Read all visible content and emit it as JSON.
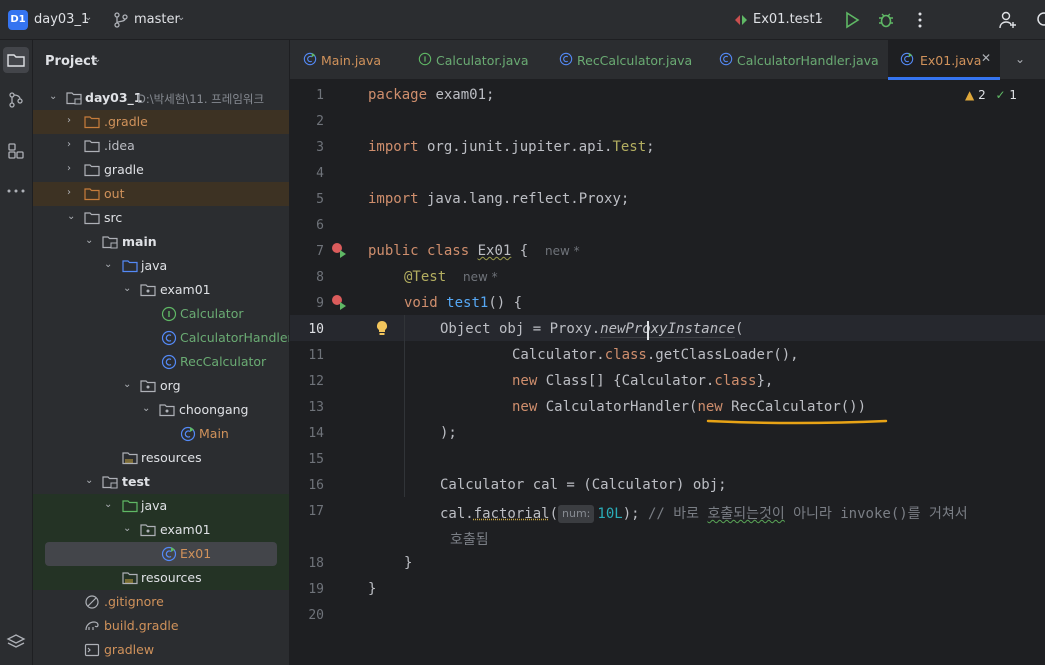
{
  "topbar": {
    "project_badge": "D1",
    "project_name": "day03_1",
    "branch": "master",
    "run_config": "Ex01.test1"
  },
  "project_panel": {
    "title": "Project",
    "root_name": "day03_1",
    "root_path": "D:\\박세현\\11. 프레임워크",
    "items": [
      {
        "label": ".gradle"
      },
      {
        "label": ".idea"
      },
      {
        "label": "gradle"
      },
      {
        "label": "out"
      },
      {
        "label": "src"
      },
      {
        "label": "main"
      },
      {
        "label": "java"
      },
      {
        "label": "exam01"
      },
      {
        "label": "Calculator"
      },
      {
        "label": "CalculatorHandler"
      },
      {
        "label": "RecCalculator"
      },
      {
        "label": "org"
      },
      {
        "label": "choongang"
      },
      {
        "label": "Main"
      },
      {
        "label": "resources"
      },
      {
        "label": "test"
      },
      {
        "label": "java"
      },
      {
        "label": "exam01"
      },
      {
        "label": "Ex01"
      },
      {
        "label": "resources"
      },
      {
        "label": ".gitignore"
      },
      {
        "label": "build.gradle"
      },
      {
        "label": "gradlew"
      }
    ]
  },
  "tabs": [
    {
      "label": "Main.java"
    },
    {
      "label": "Calculator.java"
    },
    {
      "label": "RecCalculator.java"
    },
    {
      "label": "CalculatorHandler.java"
    },
    {
      "label": "Ex01.java"
    }
  ],
  "editor": {
    "warnings": "2",
    "checks": "1",
    "line_numbers": [
      "1",
      "2",
      "3",
      "4",
      "5",
      "6",
      "7",
      "8",
      "9",
      "10",
      "11",
      "12",
      "13",
      "14",
      "15",
      "16",
      "17",
      "18",
      "19",
      "20"
    ],
    "hints": {
      "new": "new *",
      "param": "num:"
    },
    "code": {
      "l1_kw": "package",
      "l1_rest": " exam01;",
      "l3_kw": "import",
      "l3_a": " org.junit.jupiter.api.",
      "l3_b": "Test",
      "l3_c": ";",
      "l5_kw": "import",
      "l5_rest": " java.lang.reflect.Proxy;",
      "l7_kw": "public class",
      "l7_cls": "Ex01",
      "l7_rest": " {",
      "l8_ann": "@Test",
      "l9_kw": "void",
      "l9_fn": "test1",
      "l9_rest": "() {",
      "l10_a": "Object obj = Proxy.",
      "l10_b": "newProxyInstance",
      "l10_c": "(",
      "l11_a": "Calculator.",
      "l11_kw": "class",
      "l11_b": ".getClassLoader(),",
      "l12_kw": "new",
      "l12_a": " Class[] {Calculator.",
      "l12_kw2": "class",
      "l12_b": "},",
      "l13_kw": "new",
      "l13_a": " CalculatorHandler(",
      "l13_kw2": "new",
      "l13_b": " RecCalculator())",
      "l14": ");",
      "l16": "Calculator cal = (Calculator) obj;",
      "l17_a": "cal.",
      "l17_fn": "factorial",
      "l17_b": "(",
      "l17_num": "10L",
      "l17_c": ");",
      "l17_cmt_a": "// 바로 ",
      "l17_cmt_typo": "호출되는것이",
      "l17_cmt_b": " 아니라 invoke()를 거쳐서",
      "l17_cmt_wrap": "호출됨",
      "l18": "}",
      "l19": "}"
    }
  },
  "colors": {
    "accent": "#3574f0",
    "keyword": "#cf8e6d",
    "annotation": "#b3ae60",
    "method": "#56a8f5",
    "number": "#2aacb8",
    "comment": "#7a7e85",
    "highlight_underline": "#e8a316"
  }
}
